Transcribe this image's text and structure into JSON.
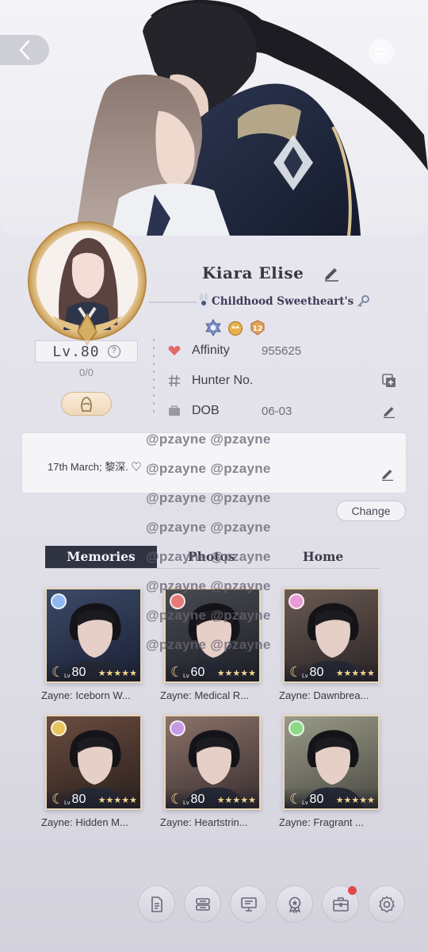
{
  "profile": {
    "name": "Kiara Elise",
    "title": "Childhood Sweetheart's",
    "level": "Lv.80",
    "level_progress": "0/0"
  },
  "info": {
    "affinity_label": "Affinity",
    "affinity_value": "955625",
    "hunter_label": "Hunter No.",
    "dob_label": "DOB",
    "dob_value": "06-03"
  },
  "bio": {
    "text": "17th March; 黎深. ♡",
    "change_label": "Change"
  },
  "watermark": {
    "lines": [
      "@pzayne  @pzayne",
      "@pzayne  @pzayne",
      "@pzayne  @pzayne",
      "@pzayne  @pzayne",
      "@pzayne  @pzayne",
      "@pzayne  @pzayne",
      "@pzayne  @pzayne",
      "@pzayne  @pzayne"
    ]
  },
  "tabs": [
    "Memories",
    "Photos",
    "Home"
  ],
  "cards": [
    {
      "title": "Zayne: Iceborn W...",
      "level": "80",
      "lv": "Lv",
      "stars": "★★★★★",
      "badge_color": "#8fb6ef",
      "bg": [
        "#1a2036",
        "#3c4a66"
      ]
    },
    {
      "title": "Zayne: Medical R...",
      "level": "60",
      "lv": "Lv",
      "stars": "★★★★★",
      "badge_color": "#e57a78",
      "bg": [
        "#1d1f26",
        "#494a52"
      ]
    },
    {
      "title": "Zayne: Dawnbrea...",
      "level": "80",
      "lv": "Lv",
      "stars": "★★★★★",
      "badge_color": "#e79ad6",
      "bg": [
        "#2b2426",
        "#6a5a52"
      ]
    },
    {
      "title": "Zayne: Hidden M...",
      "level": "80",
      "lv": "Lv",
      "stars": "★★★★★",
      "badge_color": "#e8c35e",
      "bg": [
        "#2a201c",
        "#6a4c40"
      ]
    },
    {
      "title": "Zayne: Heartstrin...",
      "level": "80",
      "lv": "Lv",
      "stars": "★★★★★",
      "badge_color": "#c79ae6",
      "bg": [
        "#3a2e30",
        "#8a7268"
      ]
    },
    {
      "title": "Zayne: Fragrant ...",
      "level": "80",
      "lv": "Lv",
      "stars": "★★★★★",
      "badge_color": "#8cd98a",
      "bg": [
        "#4a4a44",
        "#9a9a88"
      ]
    }
  ],
  "bottom_bar": [
    {
      "icon": "document-icon"
    },
    {
      "icon": "stack-icon"
    },
    {
      "icon": "screen-icon"
    },
    {
      "icon": "medal-icon"
    },
    {
      "icon": "briefcase-icon",
      "notification": true
    },
    {
      "icon": "gear-icon"
    }
  ],
  "colors": {
    "active_tab": "#2f3342",
    "accent_gold": "#d9b36e",
    "heart": "#e06b6b"
  }
}
